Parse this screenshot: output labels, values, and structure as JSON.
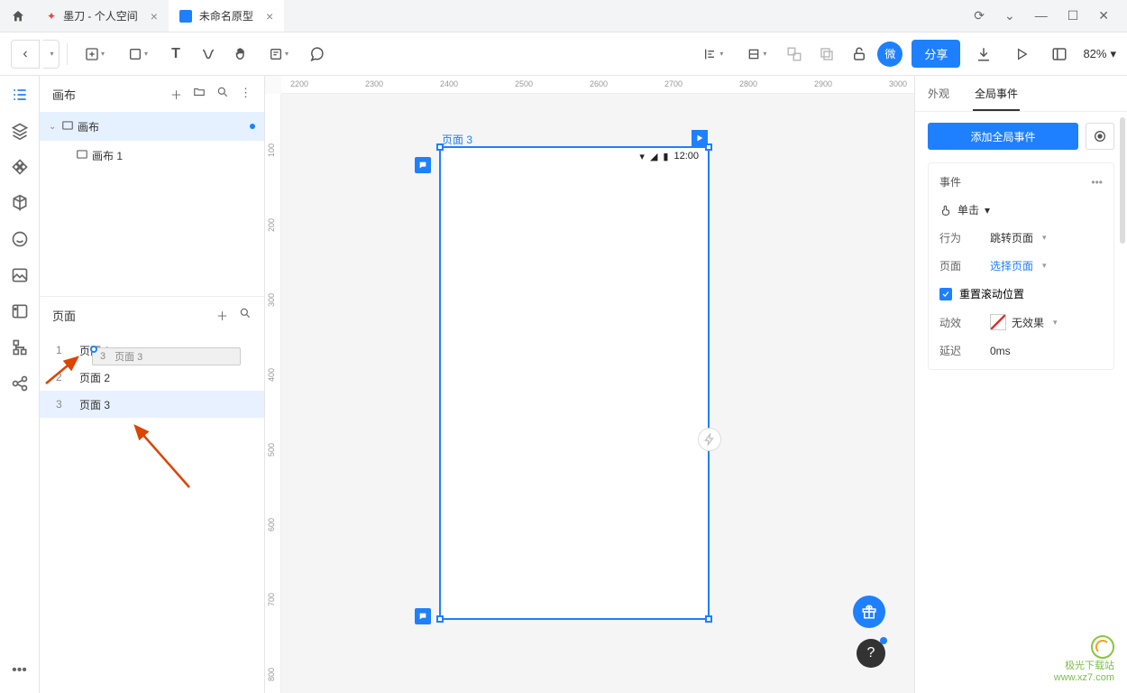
{
  "tabs": {
    "t1": "墨刀 - 个人空间",
    "t2": "未命名原型"
  },
  "toolbar": {
    "wei": "微",
    "share": "分享",
    "zoom": "82%"
  },
  "side": {
    "canvas_hd": "画布",
    "canvas_root": "画布",
    "canvas_child": "画布 1",
    "pages_hd": "页面",
    "pages": [
      {
        "idx": "1",
        "name": "页面 1"
      },
      {
        "idx": "2",
        "name": "页面 2"
      },
      {
        "idx": "3",
        "name": "页面 3"
      }
    ],
    "drag_idx": "3",
    "drag_name": "页面 3"
  },
  "ruler_h": [
    "2200",
    "2300",
    "2400",
    "2500",
    "2600",
    "2700",
    "2800",
    "2900",
    "3000"
  ],
  "ruler_v": [
    "100",
    "200",
    "300",
    "400",
    "500",
    "600",
    "700",
    "800"
  ],
  "artboard": {
    "label": "页面 3",
    "time": "12:00"
  },
  "props": {
    "tab1": "外观",
    "tab2": "全局事件",
    "add": "添加全局事件",
    "event_hd": "事件",
    "trigger": "单击",
    "behavior_lbl": "行为",
    "behavior_val": "跳转页面",
    "page_lbl": "页面",
    "page_val": "选择页面",
    "reset": "重置滚动位置",
    "effect_lbl": "动效",
    "effect_val": "无效果",
    "delay_lbl": "延迟",
    "delay_val": "0ms"
  },
  "watermark": {
    "l1": "极光下载站",
    "l2": "www.xz7.com"
  }
}
